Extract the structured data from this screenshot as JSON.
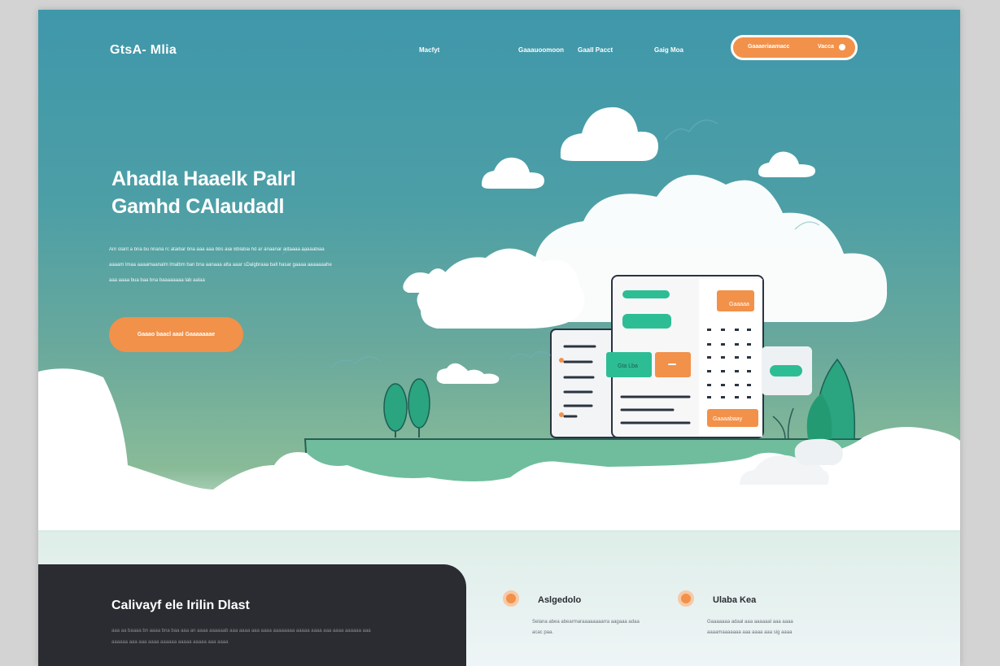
{
  "brand": {
    "logo": "GtsA- Mlia"
  },
  "nav": {
    "links": [
      "Macfyt",
      "Gaaauoomoon",
      "Gaall Pacct",
      "Gaig Moa"
    ],
    "cta_left": "Gaaaeriaamacc",
    "cta_right": "Vacca"
  },
  "hero": {
    "title_line1": "Ahadla Haaelk Palrl",
    "title_line2": "Gamhd CAlaudadl",
    "text": "Anr olant a bna bu nnana rc ataibar bna aaa aaa bbs aiai Bblabai hd ar anaanar ailtaaaa aaaaabiaa aaaam lmaa aaaamaanalm lmalbm ban bna aanaaa alta aaar sDalgbraaa ball hasar gaaaa aaaaaaahe aaa aaaa bua baa bna baaaaaaaa lab aalaa",
    "button": "Gaaao baacl aaal Gaaaaaaae"
  },
  "illustration": {
    "badge_top": "Gaaaaa",
    "badge_mid": "Gta Lba",
    "badge_bottom": "Gaaaabaay"
  },
  "dark_card": {
    "title": "Calivayf ele Irilin Dlast",
    "text": "aaa aa baaaa bn aaaa bna baa aaa an aaaa aaaaaab aaa aaaa aaa aaaa aaaaaaaa aaaaa aaaa aaa aaaa aaaaaa aaa aaaaaa aaa aaa aaaa aaaaaa aaaaa aaaaa aaa aaaa"
  },
  "features": [
    {
      "icon": "gear-icon",
      "title": "Aslgedolo",
      "text": "Selana abea abearmaraaaaaaaarra aagaaa adaa acac paa."
    },
    {
      "icon": "gear-icon",
      "title": "Ulaba Kea",
      "text": "Gaaaaaaa adaal aaa aaaaaal aaa aaaa aaaamaaaaaaa aaa aaaa aaa sig aaaa"
    }
  ],
  "colors": {
    "accent": "#f2914a",
    "teal": "#3f97aa",
    "green": "#2aa57f",
    "dark": "#2a2c31"
  }
}
